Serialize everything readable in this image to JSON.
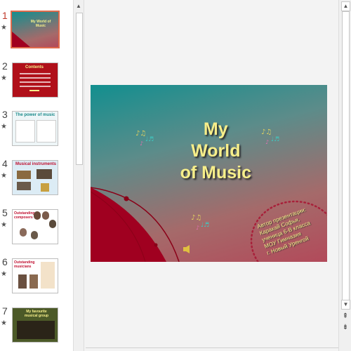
{
  "thumbnails": [
    {
      "number": "1",
      "selected": true,
      "title": "My World of Music"
    },
    {
      "number": "2",
      "selected": false,
      "title": "Contents"
    },
    {
      "number": "3",
      "selected": false,
      "title": "The power of music"
    },
    {
      "number": "4",
      "selected": false,
      "title": "Musical instruments"
    },
    {
      "number": "5",
      "selected": false,
      "title": "Outstanding composers"
    },
    {
      "number": "6",
      "selected": false,
      "title": "Outstanding musicians"
    },
    {
      "number": "7",
      "selected": false,
      "title": "My favourite musical group"
    }
  ],
  "star_glyph": "★",
  "slide": {
    "title_lines": [
      "My",
      "World",
      "of Music"
    ],
    "author_lines": [
      "Автор презентации:",
      "Каракай Софья,",
      "ученица 6-В класса",
      "МОУ Гимназия",
      "г. Новый Уренгой"
    ]
  },
  "scrollbar": {
    "up": "▲",
    "down": "▼",
    "prev_slide": "⇞",
    "next_slide": "⇟"
  },
  "colors": {
    "accent_selected": "#e06a4b",
    "title_yellow": "#f6ee8a",
    "dark_red": "#a00020"
  }
}
